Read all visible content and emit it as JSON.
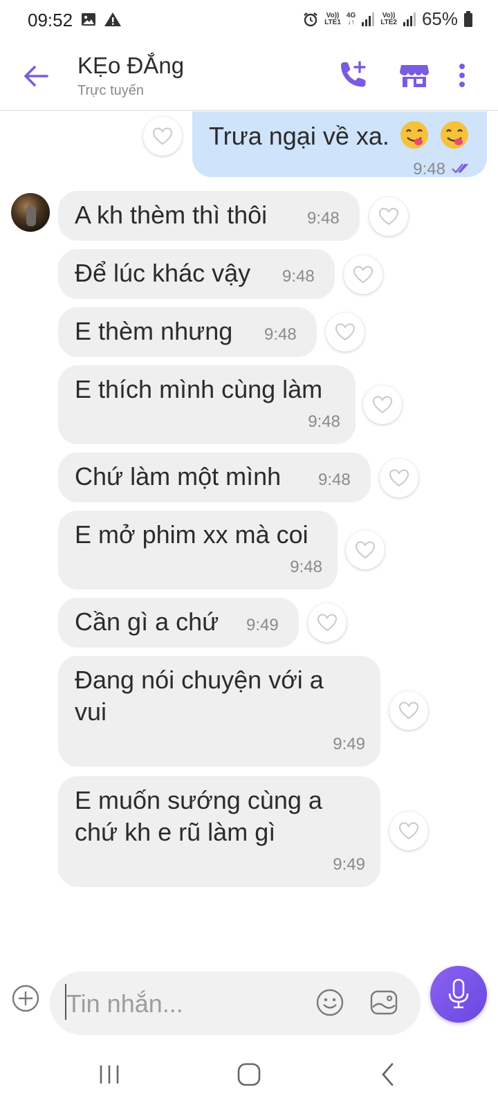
{
  "status_bar": {
    "time": "09:52",
    "battery": "65%",
    "sim1_label_top": "Vo))",
    "sim1_label_bottom": "LTE1",
    "net_label": "4G",
    "sim2_label_top": "Vo))",
    "sim2_label_bottom": "LTE2"
  },
  "header": {
    "contact_name": "KẸo ĐẮng",
    "contact_status": "Trực tuyến",
    "accent_color": "#7a5ce0"
  },
  "outgoing_message": {
    "text": "Trưa ngại về xa.",
    "time": "9:48",
    "emoji_count": 2
  },
  "incoming_messages": [
    {
      "lines": [
        "A kh thèm thì thôi"
      ],
      "time": "9:48"
    },
    {
      "lines": [
        "Để lúc khác vậy"
      ],
      "time": "9:48"
    },
    {
      "lines": [
        "E thèm nhưng"
      ],
      "time": "9:48"
    },
    {
      "lines": [
        "E thích mình cùng làm"
      ],
      "time": "9:48"
    },
    {
      "lines": [
        "Chứ làm một mình"
      ],
      "time": "9:48"
    },
    {
      "lines": [
        "E mở phim xx mà coi"
      ],
      "time": "9:48"
    },
    {
      "lines": [
        "Cần gì a chứ"
      ],
      "time": "9:49"
    },
    {
      "lines": [
        "Đang nói chuyện với a",
        "vui"
      ],
      "time": "9:49"
    },
    {
      "lines": [
        "E muốn sướng cùng a",
        "chứ kh e rũ làm gì"
      ],
      "time": "9:49"
    }
  ],
  "composer": {
    "placeholder": "Tin nhắn..."
  }
}
